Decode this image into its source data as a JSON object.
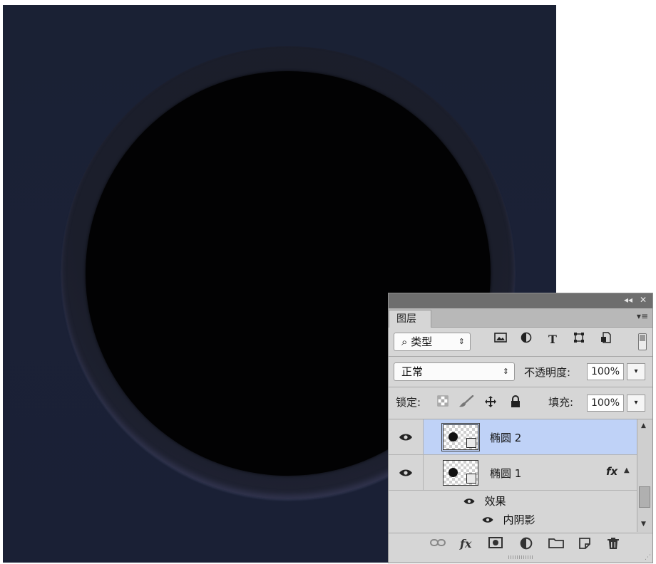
{
  "canvas": {
    "background_color": "#1a2135",
    "ring_color": "#1b1e2b",
    "disc_color": "#020203"
  },
  "panel": {
    "collapse_icon": "◂◂",
    "close_icon": "✕",
    "tab_label": "图层",
    "menu_icon": "▾≡",
    "filter": {
      "search_icon": "⌕",
      "kind_label": "类型",
      "arrows": "⇕",
      "icons": [
        "image-filter-icon",
        "adjustment-filter-icon",
        "type-filter-icon",
        "shape-filter-icon",
        "smart-object-filter-icon"
      ]
    },
    "blend_mode": "正常",
    "blend_arrows": "⇕",
    "opacity_label": "不透明度:",
    "opacity_value": "100%",
    "lock_label": "锁定:",
    "fill_label": "填充:",
    "fill_value": "100%",
    "dropdown_arrow": "▾",
    "layers": [
      {
        "name": "椭圆 2",
        "selected": true,
        "visible": true
      },
      {
        "name": "椭圆 1",
        "selected": false,
        "visible": true,
        "fx": "fx"
      }
    ],
    "effects_label": "效果",
    "inner_shadow_label": "内阴影",
    "selected_color": "#bfd2f7"
  }
}
